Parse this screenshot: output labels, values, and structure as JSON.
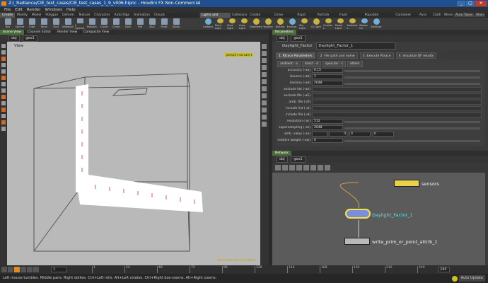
{
  "window": {
    "title": "Z:/_Radiance/CIE_test_cases/CIE_test_cases_1_9_v006.hipnc - Houdini FX Non-Commercial",
    "buttons": [
      "_",
      "▢",
      "✕"
    ]
  },
  "menu": [
    "File",
    "Edit",
    "Render",
    "Windows",
    "Help"
  ],
  "shelf_tabs_left": [
    "Create",
    "Modify",
    "Model",
    "Polygon",
    "Deform",
    "Texture",
    "Character",
    "Auto Rigs",
    "Animation",
    "Clouds"
  ],
  "shelf_tabs_right": [
    "Lights and Cameras",
    "Collisions",
    "Create Particles",
    "Drive Particles",
    "Rigid Bodies",
    "Particle Fluids",
    "Fluid Containers",
    "Populate Containers",
    "Container Tools",
    "Pyro FX",
    "Cloth",
    "Wires",
    "Fur",
    "Drive Simulation"
  ],
  "desktop_tabs": [
    "Auto Takes",
    "Main"
  ],
  "tools_left": [
    "Box",
    "Sphere",
    "Tube",
    "Torus",
    "Grid",
    "Metaball",
    "L-System",
    "Platonic",
    "Curve",
    "Circle",
    "Font",
    "File",
    "Null",
    "Rivet",
    "Sticky"
  ],
  "tools_right": [
    "Camera",
    "Point Light",
    "Spot Light",
    "Area Light",
    "Geometry",
    "Volume",
    "Distant",
    "Environ.",
    "Sky Light",
    "GI Light",
    "Caustic L.",
    "Portal Light",
    "Ambient L.",
    "Stereo Ca.",
    "Switcher"
  ],
  "pane_tabs": [
    "Scene View",
    "Channel Editor",
    "Render View",
    "Composite View"
  ],
  "viewport": {
    "path_obj": "obj",
    "path_geo": "geo1",
    "label": "View",
    "camera_button": "persp1 ▾ no cam ▾",
    "watermark": "Non-Commercial Edition"
  },
  "params": {
    "tab": "Parameters",
    "path_obj": "obj",
    "path_geo": "geo1",
    "node_type": "Daylight_Factor",
    "node_name": "Daylight_Factor_1",
    "subtabs": [
      "1. Rtrace Parameters",
      "2. File path and name",
      "3. Execute Rtrace",
      "4. Visualize DF results"
    ],
    "flags": [
      "ambient - a",
      "direct - d",
      "specular - s",
      "others"
    ],
    "rows": [
      {
        "label": "accuracy (-aa)",
        "value": "0.15",
        "kind": "num"
      },
      {
        "label": "bounce (-ab)",
        "value": "1",
        "kind": "num"
      },
      {
        "label": "division (-ad)",
        "value": "2048",
        "kind": "num"
      },
      {
        "label": "exclude list (-ae)",
        "value": "",
        "kind": "text"
      },
      {
        "label": "exclude file (-aE)",
        "value": "",
        "kind": "text"
      },
      {
        "label": "amb. file (-af)",
        "value": "",
        "kind": "text"
      },
      {
        "label": "include list (-ai)",
        "value": "",
        "kind": "text"
      },
      {
        "label": "include file (-aI)",
        "value": "",
        "kind": "text"
      },
      {
        "label": "resolution (-ar)",
        "value": "512",
        "kind": "num"
      },
      {
        "label": "supersampling (-as)",
        "value": "2048",
        "kind": "num"
      },
      {
        "label": "amb. value (-av)",
        "value": "0",
        "kind": "triple",
        "v2": "0",
        "v3": "0"
      },
      {
        "label": "relative weight (-aw)",
        "value": "0",
        "kind": "num"
      }
    ]
  },
  "network": {
    "tab": "Network",
    "path_obj": "obj",
    "path_geo": "geo1",
    "nodes": [
      {
        "name": "sensors",
        "color": "#e8d24a"
      },
      {
        "name": "Daylight_Factor_1",
        "color": "#7b8fd8"
      },
      {
        "name": "write_prim_or_point_attrib_1",
        "color": "#b8b8b8"
      }
    ]
  },
  "timeline": {
    "current_frame": "1",
    "ticks": [
      "1",
      "24",
      "48",
      "72",
      "96",
      "120",
      "144",
      "168",
      "192",
      "216",
      "240"
    ],
    "end_frame": "240"
  },
  "status": {
    "text": "Left mouse tumbles. Middle pans. Right dollies. Ctrl+Left rolls. Alt+Left rotates. Ctrl+Right box-zooms. Alt+Right zooms.",
    "auto_update": "Auto Update"
  },
  "colors": {
    "accent": "#e08a22",
    "title_bar": "#1f4f8f",
    "active_tab": "#4c6f3a",
    "viewport_bg": "#b9b9b9"
  }
}
